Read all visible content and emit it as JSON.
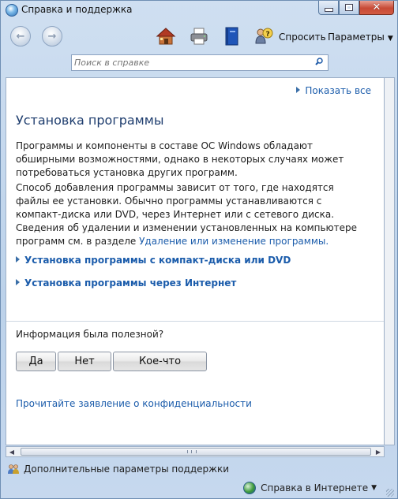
{
  "window": {
    "title": "Справка и поддержка"
  },
  "toolbar": {
    "ask_label": "Спросить",
    "options_label": "Параметры"
  },
  "search": {
    "placeholder": "Поиск в справке"
  },
  "content": {
    "show_all": "Показать все",
    "heading": "Установка программы",
    "para1": "Программы и компоненты в составе ОС Windows обладают обширными возможностями, однако в некоторых случаях может потребоваться установка других программ.",
    "para2_text": "Способ добавления программы зависит от того, где находятся файлы ее установки. Обычно программы устанавливаются с компакт-диска или DVD, через Интернет или с сетевого диска. Сведения об удалении и изменении установленных на компьютере программ см. в разделе ",
    "para2_link": "Удаление или изменение программы.",
    "sections": [
      {
        "label": "Установка программы с компакт-диска или DVD"
      },
      {
        "label": "Установка программы через Интернет"
      }
    ],
    "feedback": {
      "question": "Информация была полезной?",
      "yes": "Да",
      "no": "Нет",
      "somewhat": "Кое-что"
    },
    "privacy_link": "Прочитайте заявление о конфиденциальности"
  },
  "footer": {
    "more_support": "Дополнительные параметры поддержки",
    "online_help": "Справка в Интернете"
  }
}
